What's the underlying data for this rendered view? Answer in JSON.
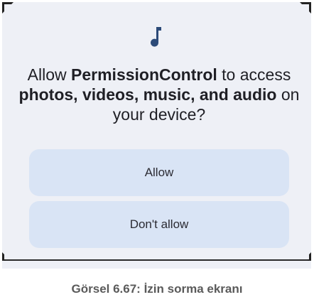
{
  "dialog": {
    "icon": "music-note-icon",
    "prompt": {
      "pre": "Allow ",
      "app_name": "PermissionControl",
      "mid1": " to access ",
      "media": "photos, videos, music, and audio",
      "post": " on your device?"
    },
    "buttons": {
      "allow_label": "Allow",
      "deny_label": "Don't allow"
    }
  },
  "caption": "Görsel 6.67: İzin sorma ekranı",
  "colors": {
    "dialog_bg": "#eef0f6",
    "button_bg": "#d9e4f5",
    "text": "#1f1f25"
  }
}
